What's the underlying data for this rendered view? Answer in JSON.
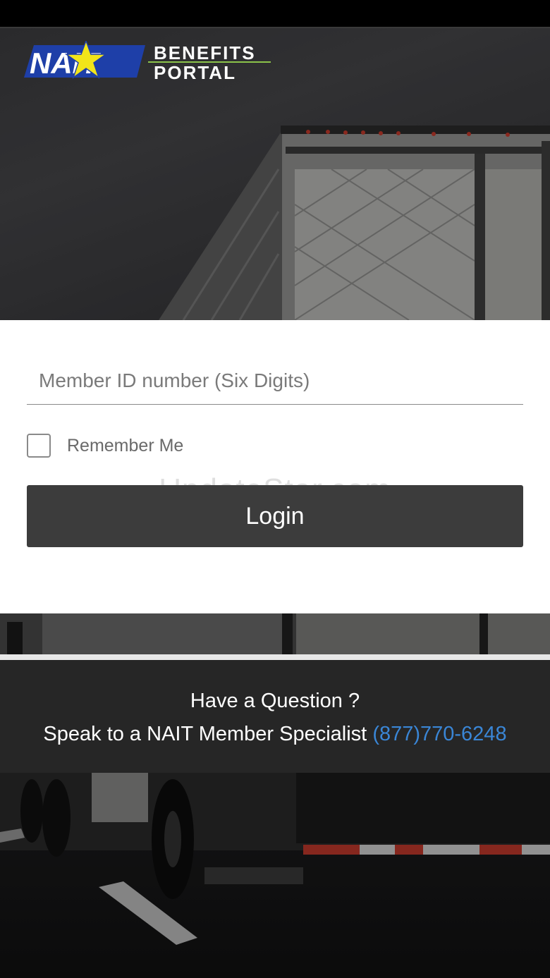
{
  "logo": {
    "brand": "NAIT",
    "line1": "BENEFITS",
    "line2": "PORTAL"
  },
  "login": {
    "member_id_placeholder": "Member ID number (Six Digits)",
    "member_id_value": "",
    "remember_label": "Remember Me",
    "remember_checked": false,
    "button_label": "Login"
  },
  "watermark": "UpdateStar.com",
  "help": {
    "title": "Have a Question ?",
    "text": "Speak to a NAIT Member Specialist",
    "phone": "(877)770-6248"
  },
  "colors": {
    "button": "#3c3c3c",
    "link": "#3a86d6",
    "logo_blue": "#1e3fa8",
    "logo_star": "#f2e51a",
    "logo_accent": "#8bc34a"
  }
}
